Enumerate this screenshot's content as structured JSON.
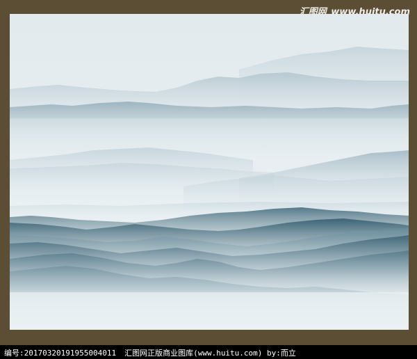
{
  "watermark": {
    "site_name": "汇图网",
    "site_url": "www.huitu.com"
  },
  "caption": {
    "id_label": "编号:",
    "id_value": "20170320191955004011",
    "library": "汇图网正版商业图库(www.huitu.com)",
    "author": "by:而立"
  },
  "colors": {
    "frame": "#5b4e34",
    "sky": "#e6eef1",
    "mist_far": "#b9cad2",
    "ridge_mid": "#9fb6c1",
    "ridge_dark": "#3f6678",
    "caption_bar": "#000000"
  }
}
